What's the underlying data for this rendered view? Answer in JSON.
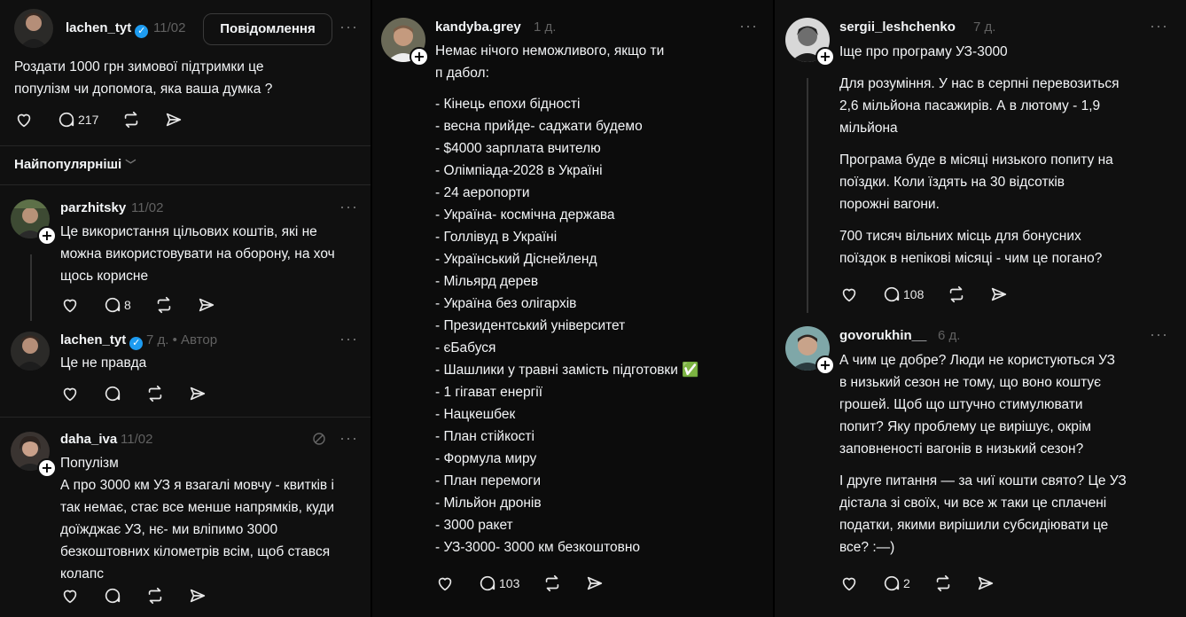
{
  "col1": {
    "op": {
      "username": "lachen_tyt",
      "time": "11/02",
      "message_button": "Повідомлення",
      "more": "···",
      "text": "Роздати 1000 грн зимової підтримки це\nпопулізм чи допомога, яка ваша думка ?",
      "replies": "217"
    },
    "sort_label": "Найпопулярніші",
    "reply1": {
      "username": "parzhitsky",
      "time": "11/02",
      "more": "···",
      "text": "Це використання цільових коштів, які не\nможна використовувати на оборону, на хоч\nщось корисне",
      "replies": "8"
    },
    "reply2": {
      "username": "lachen_tyt",
      "time": "7 д.",
      "author_tag": "• Автор",
      "more": "···",
      "text": "Це не правда"
    },
    "reply3": {
      "username": "daha_iva",
      "time": "11/02",
      "more": "···",
      "text": "Популізм\nА про 3000 км УЗ я взагалі мовчу - квитків і\nтак немає, стає все менше напрямків, куди\nдоїжджає УЗ, нє- ми вліпимо 3000\nбезкоштовних кілометрів всім, щоб стався\nколапс"
    }
  },
  "col2": {
    "post": {
      "username": "kandyba.grey",
      "time": "1 д.",
      "more": "···",
      "intro": "Немає нічого неможливого, якщо ти\nп  дабол:",
      "items": [
        "- Кінець епохи бідності",
        "- весна прийде- саджати будемо",
        "- $4000 зарплата вчителю",
        "- Олімпіада-2028 в Україні",
        "- 24 аеропорти",
        "- Україна- космічна держава",
        "- Голлівуд в Україні",
        "- Український Діснейленд",
        "- Мільярд дерев",
        "- Україна без олігархів",
        "- Президентський університет",
        "- єБабуся",
        "- Шашлики у травні замість підготовки ✅",
        "- 1 гігават енергії",
        "- Нацкешбек",
        "- План стійкості",
        "- Формула миру",
        "- План перемоги",
        "- Мільйон дронів",
        "- 3000 ракет",
        "- УЗ-3000- 3000 км безкоштовно"
      ],
      "replies": "103"
    }
  },
  "col3": {
    "post1": {
      "username": "sergii_leshchenko",
      "time": "7 д.",
      "more": "···",
      "p1": "Іще про програму УЗ-3000",
      "p2": "Для розуміння. У нас в серпні перевозиться\n2,6 мільйона пасажирів. А в лютому - 1,9\nмільйона",
      "p3": "Програма буде в місяці низького попиту на\nпоїздки. Коли їздять на 30 відсотків\nпорожні вагони.",
      "p4": "700 тисяч вільних місць для бонусних\nпоїздок в непікові місяці - чим це погано?",
      "replies": "108"
    },
    "post2": {
      "username": "govorukhin__",
      "time": "6 д.",
      "more": "···",
      "p1": "А чим це добре? Люди не користуються УЗ\nв низький сезон не тому, що воно коштує\nгрошей. Щоб що штучно стимулювати\nпопит? Яку проблему це вирішує, окрім\nзаповненості вагонів в низький сезон?",
      "p2": "І друге питання — за чиї кошти свято? Це УЗ\nдістала зі своїх, чи все ж таки це сплачені\nподатки, якими вирішили субсидіювати це\nвсе? :—)",
      "replies": "2"
    }
  },
  "colors": {
    "background": "#101010",
    "text": "#f3f5f7",
    "muted": "#616161",
    "verified": "#1d9bf0"
  }
}
